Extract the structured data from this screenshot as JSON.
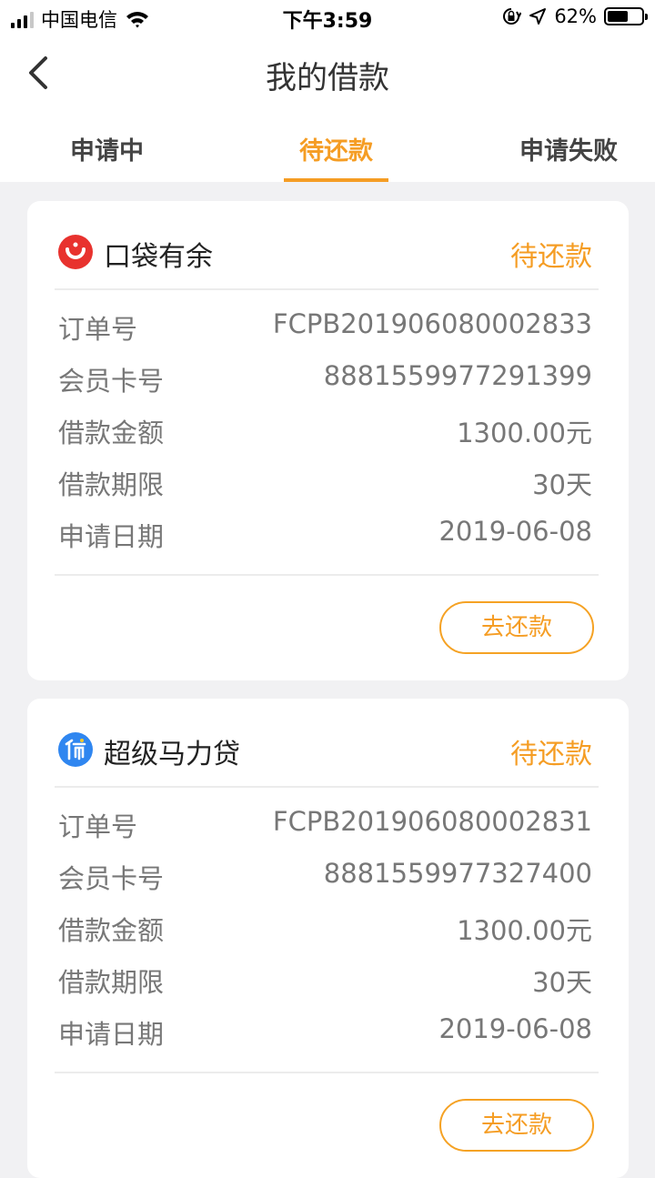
{
  "status_bar": {
    "carrier": "中国电信",
    "time": "下午3:59",
    "battery_percent": "62%",
    "battery_level": 0.62,
    "signal_icon": "signal-icon",
    "wifi_icon": "wifi-icon",
    "lock_icon": "orientation-lock-icon",
    "location_icon": "location-arrow-icon"
  },
  "nav": {
    "title": "我的借款",
    "back_icon": "chevron-left-icon"
  },
  "tabs": [
    {
      "label": "申请中",
      "active": false
    },
    {
      "label": "待还款",
      "active": true
    },
    {
      "label": "申请失败",
      "active": false
    }
  ],
  "colors": {
    "accent": "#f59d24",
    "background": "#f1f1f3",
    "brand1": "#e8322e",
    "brand2": "#2f86f0"
  },
  "loans": [
    {
      "brand": "口袋有余",
      "brand_icon": "smile-logo-icon",
      "status": "待还款",
      "rows": [
        {
          "label": "订单号",
          "value": "FCPB201906080002833"
        },
        {
          "label": "会员卡号",
          "value": "8881559977291399"
        },
        {
          "label": "借款金额",
          "value": "1300.00元"
        },
        {
          "label": "借款期限",
          "value": "30天"
        },
        {
          "label": "申请日期",
          "value": "2019-06-08"
        }
      ],
      "button": "去还款"
    },
    {
      "brand": "超级马力贷",
      "brand_icon": "mali-logo-icon",
      "status": "待还款",
      "rows": [
        {
          "label": "订单号",
          "value": "FCPB201906080002831"
        },
        {
          "label": "会员卡号",
          "value": "8881559977327400"
        },
        {
          "label": "借款金额",
          "value": "1300.00元"
        },
        {
          "label": "借款期限",
          "value": "30天"
        },
        {
          "label": "申请日期",
          "value": "2019-06-08"
        }
      ],
      "button": "去还款"
    }
  ]
}
